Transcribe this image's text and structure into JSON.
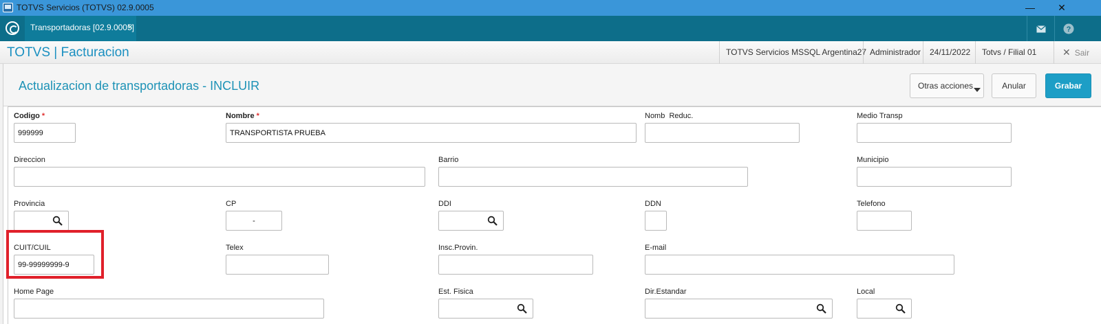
{
  "window": {
    "title": "TOTVS Servicios (TOTVS) 02.9.0005",
    "minimize": "—",
    "restore": "❐",
    "close": "✕"
  },
  "tabbar": {
    "tab_label": "Transportadoras [02.9.0005]",
    "tab_close": "×",
    "mail_icon": "mail-icon",
    "help_icon": "help-icon"
  },
  "header": {
    "brand": "TOTVS | Facturacion",
    "server": "TOTVS Servicios MSSQL Argentina27",
    "user": "Administrador",
    "date": "24/11/2022",
    "branch": "Totvs / Filial 01",
    "exit_label": "Sair"
  },
  "page": {
    "title": "Actualizacion de transportadoras - INCLUIR",
    "other_actions": "Otras acciones",
    "cancel": "Anular",
    "save": "Grabar"
  },
  "fields": {
    "codigo": {
      "label": "Codigo",
      "value": "999999",
      "required": "*"
    },
    "nombre": {
      "label": "Nombre",
      "value": "TRANSPORTISTA PRUEBA",
      "required": "*"
    },
    "nomb_reduc": {
      "label": "Nomb  Reduc.",
      "value": ""
    },
    "medio_transp": {
      "label": "Medio Transp",
      "value": ""
    },
    "direccion": {
      "label": "Direccion",
      "value": ""
    },
    "barrio": {
      "label": "Barrio",
      "value": ""
    },
    "municipio": {
      "label": "Municipio",
      "value": ""
    },
    "provincia": {
      "label": "Provincia",
      "value": ""
    },
    "cp": {
      "label": "CP",
      "value": "-"
    },
    "ddi": {
      "label": "DDI",
      "value": ""
    },
    "ddn": {
      "label": "DDN",
      "value": ""
    },
    "telefono": {
      "label": "Telefono",
      "value": ""
    },
    "cuit": {
      "label": "CUIT/CUIL",
      "value": "99-99999999-9"
    },
    "telex": {
      "label": "Telex",
      "value": ""
    },
    "insc_provin": {
      "label": "Insc.Provin.",
      "value": ""
    },
    "email": {
      "label": "E-mail",
      "value": ""
    },
    "home_page": {
      "label": "Home Page",
      "value": ""
    },
    "est_fisica": {
      "label": "Est. Fisica",
      "value": ""
    },
    "dir_estandar": {
      "label": "Dir.Estandar",
      "value": ""
    },
    "local": {
      "label": "Local",
      "value": ""
    }
  },
  "colors": {
    "titlebar": "#3a96d9",
    "tabbar": "#0d6e8a",
    "brand": "#1a8fc0",
    "primary_button": "#1d9ec6",
    "highlight": "#e0202a",
    "required": "#e03030"
  }
}
